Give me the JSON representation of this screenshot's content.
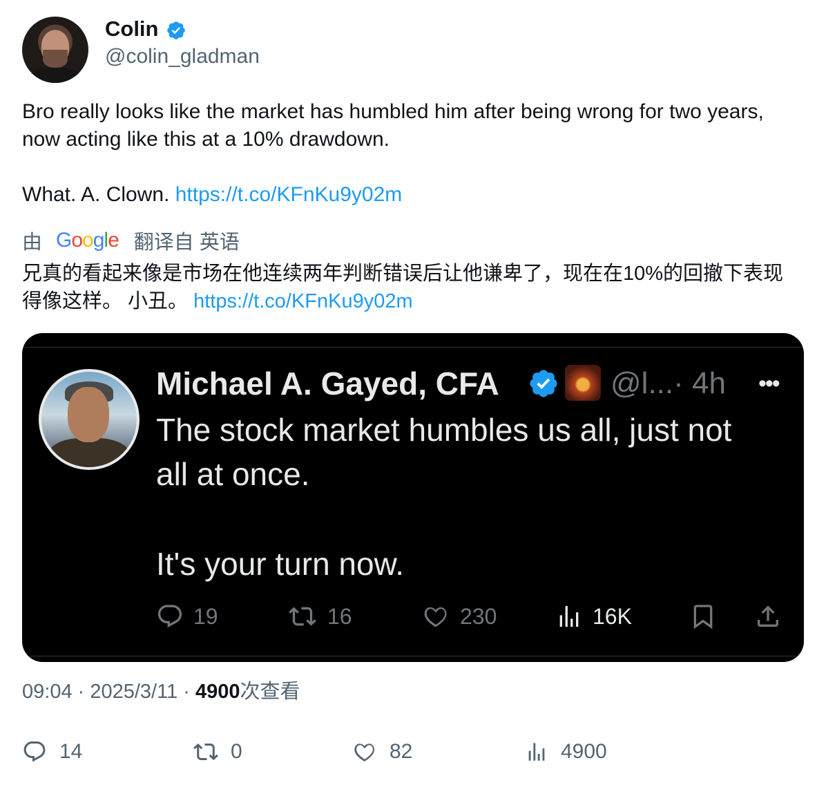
{
  "author": {
    "display_name": "Colin",
    "handle": "@colin_gladman",
    "verified_color": "#1d9bf0"
  },
  "tweet": {
    "line1": "Bro really looks like the market has humbled him after being wrong for two years, now acting like this at a 10% drawdown.",
    "line3_text": "What. A. Clown. ",
    "link": "https://t.co/KFnKu9y02m"
  },
  "translation": {
    "by": "由",
    "provider": "Google",
    "from": "翻译自 英语",
    "text": "兄真的看起来像是市场在他连续两年判断错误后让他谦卑了，现在在10%的回撤下表现得像这样。 小丑。 ",
    "link": "https://t.co/KFnKu9y02m"
  },
  "embedded": {
    "display_name": "Michael A. Gayed, CFA",
    "handle": "@l...",
    "time": "· 4h",
    "more": "•••",
    "text_line1": "The stock market humbles us all, just not",
    "text_line2": "all at once.",
    "text_line3": "It's your turn now.",
    "replies": "19",
    "retweets": "16",
    "likes": "230",
    "views": "16K"
  },
  "meta": {
    "time": "09:04 · 2025/3/11 · ",
    "views_count": "4900",
    "views_label": "次查看"
  },
  "metrics": {
    "replies": "14",
    "retweets": "0",
    "likes": "82",
    "views": "4900"
  }
}
